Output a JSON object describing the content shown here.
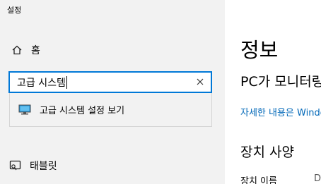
{
  "window": {
    "title": "설정"
  },
  "sidebar": {
    "home": {
      "label": "홈",
      "icon": "home-icon"
    },
    "tablet": {
      "label": "태블릿",
      "icon": "tablet-icon"
    }
  },
  "search": {
    "value": "고급 시스템",
    "clear_icon": "close-icon",
    "accent": "#0078d7",
    "suggestions": [
      {
        "label": "고급 시스템 설정 보기",
        "icon": "monitor-icon"
      }
    ]
  },
  "main": {
    "page_title": "정보",
    "monitor_heading": "PC가 모니터링되고",
    "details_link": "자세한 내용은 Windows",
    "link_color": "#0067b8",
    "device_heading": "장치 사양",
    "device_name_label": "장치 이름",
    "device_name_value": "D"
  }
}
